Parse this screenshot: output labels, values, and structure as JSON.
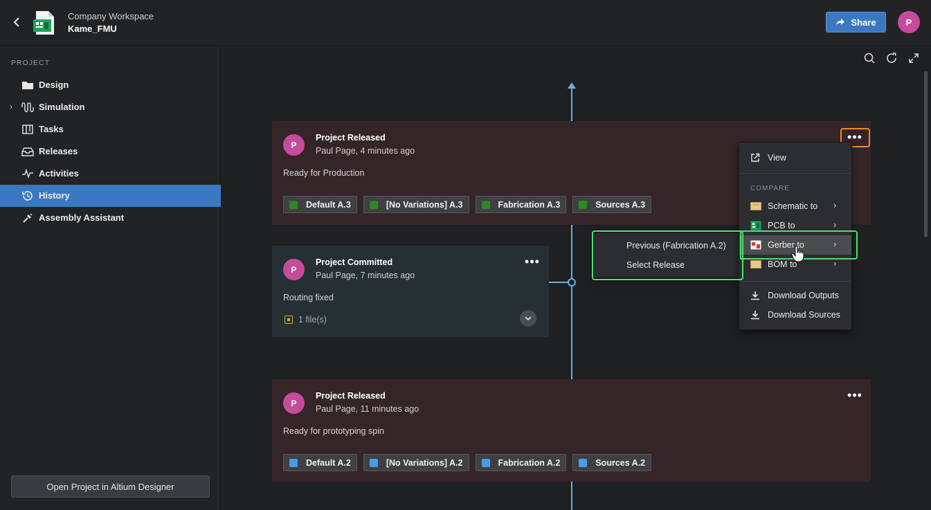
{
  "header": {
    "workspace": "Company Workspace",
    "project": "Kame_FMU",
    "share_label": "Share",
    "avatar_initial": "P"
  },
  "sidebar": {
    "heading": "PROJECT",
    "items": [
      {
        "label": "Design",
        "icon": "folder-icon"
      },
      {
        "label": "Simulation",
        "icon": "waveform-icon"
      },
      {
        "label": "Tasks",
        "icon": "board-icon"
      },
      {
        "label": "Releases",
        "icon": "inbox-icon"
      },
      {
        "label": "Activities",
        "icon": "pulse-icon"
      },
      {
        "label": "History",
        "icon": "history-icon",
        "active": true
      },
      {
        "label": "Assembly Assistant",
        "icon": "wrench-icon"
      }
    ],
    "open_button": "Open Project in Altium Designer"
  },
  "timeline": {
    "entries": [
      {
        "type": "release",
        "avatar": "P",
        "title": "Project Released",
        "subtitle": "Paul Page, 4 minutes ago",
        "message": "Ready for Production",
        "tags": [
          {
            "label": "Default A.3",
            "color": "#2a8a1f"
          },
          {
            "label": "[No Variations] A.3",
            "color": "#2a8a1f"
          },
          {
            "label": "Fabrication A.3",
            "color": "#2a8a1f"
          },
          {
            "label": "Sources A.3",
            "color": "#2a8a1f"
          }
        ]
      },
      {
        "type": "commit",
        "avatar": "P",
        "title": "Project Committed",
        "subtitle": "Paul Page, 7 minutes ago",
        "message": "Routing fixed",
        "files": "1 file(s)"
      },
      {
        "type": "release",
        "avatar": "P",
        "title": "Project Released",
        "subtitle": "Paul Page, 11 minutes ago",
        "message": "Ready for prototyping spin",
        "tags": [
          {
            "label": "Default A.2",
            "color": "#4b9be8"
          },
          {
            "label": "[No Variations] A.2",
            "color": "#4b9be8"
          },
          {
            "label": "Fabrication A.2",
            "color": "#4b9be8"
          },
          {
            "label": "Sources A.2",
            "color": "#4b9be8"
          }
        ]
      }
    ]
  },
  "context_menu": {
    "view": "View",
    "compare_heading": "COMPARE",
    "schematic": "Schematic to",
    "pcb": "PCB to",
    "gerber": "Gerber to",
    "bom": "BOM to",
    "download_outputs": "Download Outputs",
    "download_sources": "Download Sources"
  },
  "submenu": {
    "previous": "Previous (Fabrication A.2)",
    "select": "Select Release"
  },
  "colors": {
    "accent": "#3a78c2",
    "timeline": "#5fb4e8",
    "highlight_orange": "#f28a2e",
    "highlight_green": "#4ee06b",
    "avatar": "#c54b9b"
  }
}
